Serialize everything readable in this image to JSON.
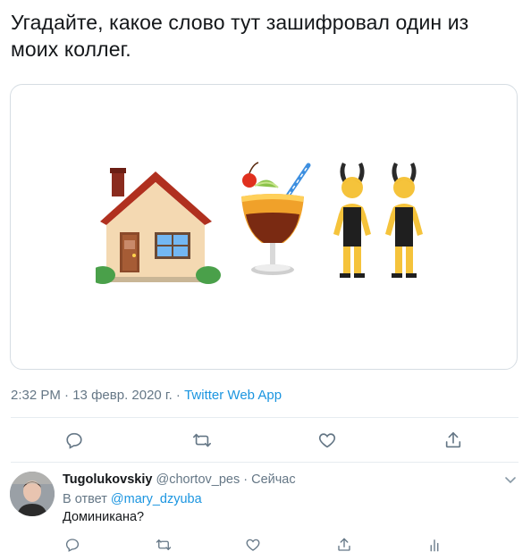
{
  "tweet": {
    "text": "Угадайте, какое слово тут зашифровал один из моих коллег.",
    "emoji": [
      "house",
      "tropical-drink",
      "people-with-bunny-ears"
    ],
    "time": "2:32 PM",
    "date": "13 февр. 2020 г.",
    "sep": "·",
    "source": "Twitter Web App"
  },
  "actions": {
    "icons": [
      "reply-icon",
      "retweet-icon",
      "like-icon",
      "share-icon"
    ]
  },
  "reply": {
    "name": "Tugolukovskiy",
    "handle": "@chortov_pes",
    "dot": "·",
    "time": "Сейчас",
    "reply_prefix": "В ответ",
    "reply_mention": "@mary_dzyuba",
    "text": "Доминикана?",
    "icons": [
      "reply-icon",
      "retweet-icon",
      "like-icon",
      "share-icon",
      "analytics-icon"
    ]
  },
  "colors": {
    "accent": "#1b95e0",
    "muted": "#657786",
    "border": "#e6ecf0"
  }
}
